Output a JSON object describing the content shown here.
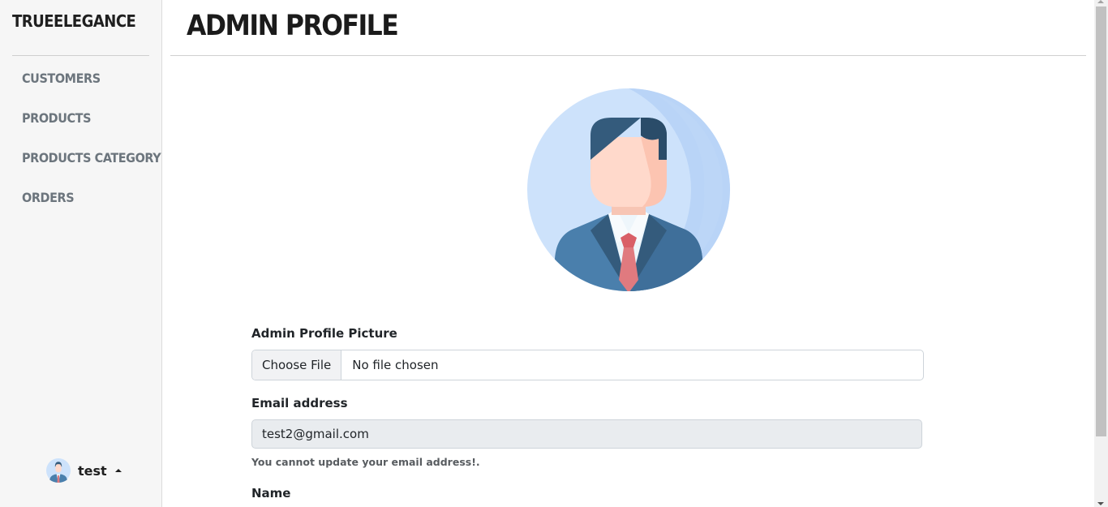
{
  "sidebar": {
    "brand": "TRUEELEGANCE",
    "items": [
      {
        "label": "CUSTOMERS"
      },
      {
        "label": "PRODUCTS"
      },
      {
        "label": "PRODUCTS CATEGORY"
      },
      {
        "label": "ORDERS"
      }
    ],
    "user": {
      "name": "test",
      "avatar_icon": "user-avatar-icon"
    }
  },
  "header": {
    "title": "ADMIN PROFILE"
  },
  "profile": {
    "avatar_icon": "businessman-avatar-icon",
    "colors": {
      "circle": "#cde2fb",
      "suit": "#4a7fac",
      "hair": "#345b7c",
      "skin": "#ffd9cb",
      "tie": "#e07a7f"
    }
  },
  "form": {
    "picture": {
      "label": "Admin Profile Picture",
      "button": "Choose File",
      "status": "No file chosen"
    },
    "email": {
      "label": "Email address",
      "value": "test2@gmail.com",
      "help": "You cannot update your email address!."
    },
    "name": {
      "label": "Name"
    }
  }
}
